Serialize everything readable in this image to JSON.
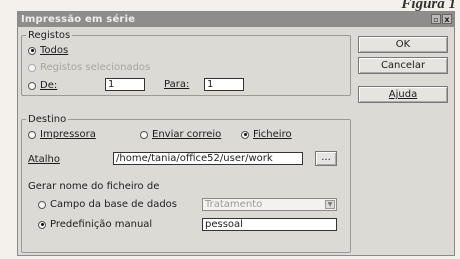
{
  "figure_caption": "Figura 1",
  "window": {
    "title": "Impressão em série",
    "title_buttons": [
      "▫",
      "x"
    ]
  },
  "records": {
    "legend": "Registos",
    "all_label": "Todos",
    "selected_label": "Registos selecionados",
    "from_label": "De:",
    "from_value": "1",
    "to_label": "Para:",
    "to_value": "1",
    "selected_option": "all"
  },
  "destination": {
    "legend": "Destino",
    "printer_label": "Impressora",
    "email_label": "Enviar correio",
    "file_label": "Ficheiro",
    "selected_option": "file",
    "path_label": "Atalho",
    "path_value": "/home/tania/office52/user/work",
    "browse_label": "...",
    "filename_heading": "Gerar nome do ficheiro de",
    "db_field_label": "Campo da base de dados",
    "db_field_value": "Tratamento",
    "manual_label": "Predefinição manual",
    "manual_value": "pessoal",
    "filename_option": "manual"
  },
  "buttons": {
    "ok": "OK",
    "cancel": "Cancelar",
    "help": "Ajuda"
  }
}
